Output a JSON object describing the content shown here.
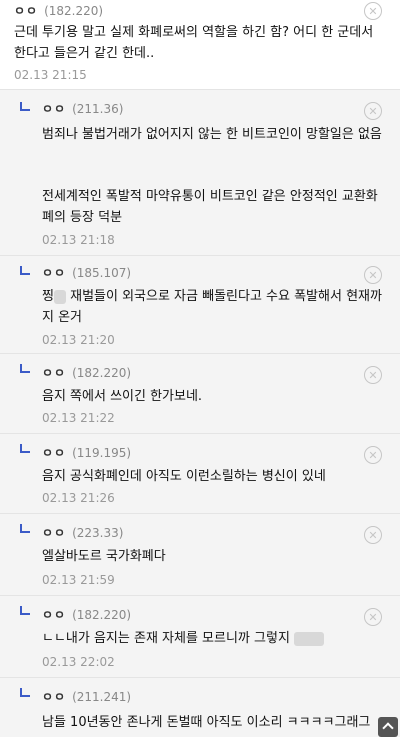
{
  "comments": [
    {
      "nick": "ㅇㅇ",
      "ip": "(182.220)",
      "text": "근데 투기용 말고 실제 화폐로써의 역할을 하긴 함? 어디 한 군데서 한다고 들은거 같긴 한데..",
      "date": "02.13 21:15"
    },
    {
      "nick": "ㅇㅇ",
      "ip": "(211.36)",
      "text1": "범죄나 불법거래가 없어지지 않는 한 비트코인이 망할일은 없음",
      "text2": "전세계적인 폭발적 마약유통이 비트코인 같은 안정적인 교환화폐의 등장 덕분",
      "date": "02.13 21:18"
    },
    {
      "nick": "ㅇㅇ",
      "ip": "(185.107)",
      "text_pre": "찡",
      "text": "재벌들이 외국으로 자금 빼돌린다고 수요 폭발해서 현재까지 온거",
      "date": "02.13 21:20"
    },
    {
      "nick": "ㅇㅇ",
      "ip": "(182.220)",
      "text": "음지 쪽에서 쓰이긴 한가보네.",
      "date": "02.13 21:22"
    },
    {
      "nick": "ㅇㅇ",
      "ip": "(119.195)",
      "text": "음지 공식화폐인데 아직도 이런소릴하는 병신이 있네",
      "date": "02.13 21:26"
    },
    {
      "nick": "ㅇㅇ",
      "ip": "(223.33)",
      "text": "엘살바도르 국가화폐다",
      "date": "02.13 21:59"
    },
    {
      "nick": "ㅇㅇ",
      "ip": "(182.220)",
      "text": "ㄴㄴ내가 음지는 존재 자체를 모르니까 그렇지",
      "date": "02.13 22:02"
    },
    {
      "nick": "ㅇㅇ",
      "ip": "(211.241)",
      "text": "남들 10년동안 존나게 돈벌때 아직도 이소리 ㅋㅋㅋㅋ그래그"
    }
  ],
  "icons": {
    "delete": "close-circle-icon",
    "reply": "reply-arrow-icon",
    "scroll": "scroll-top-icon"
  }
}
